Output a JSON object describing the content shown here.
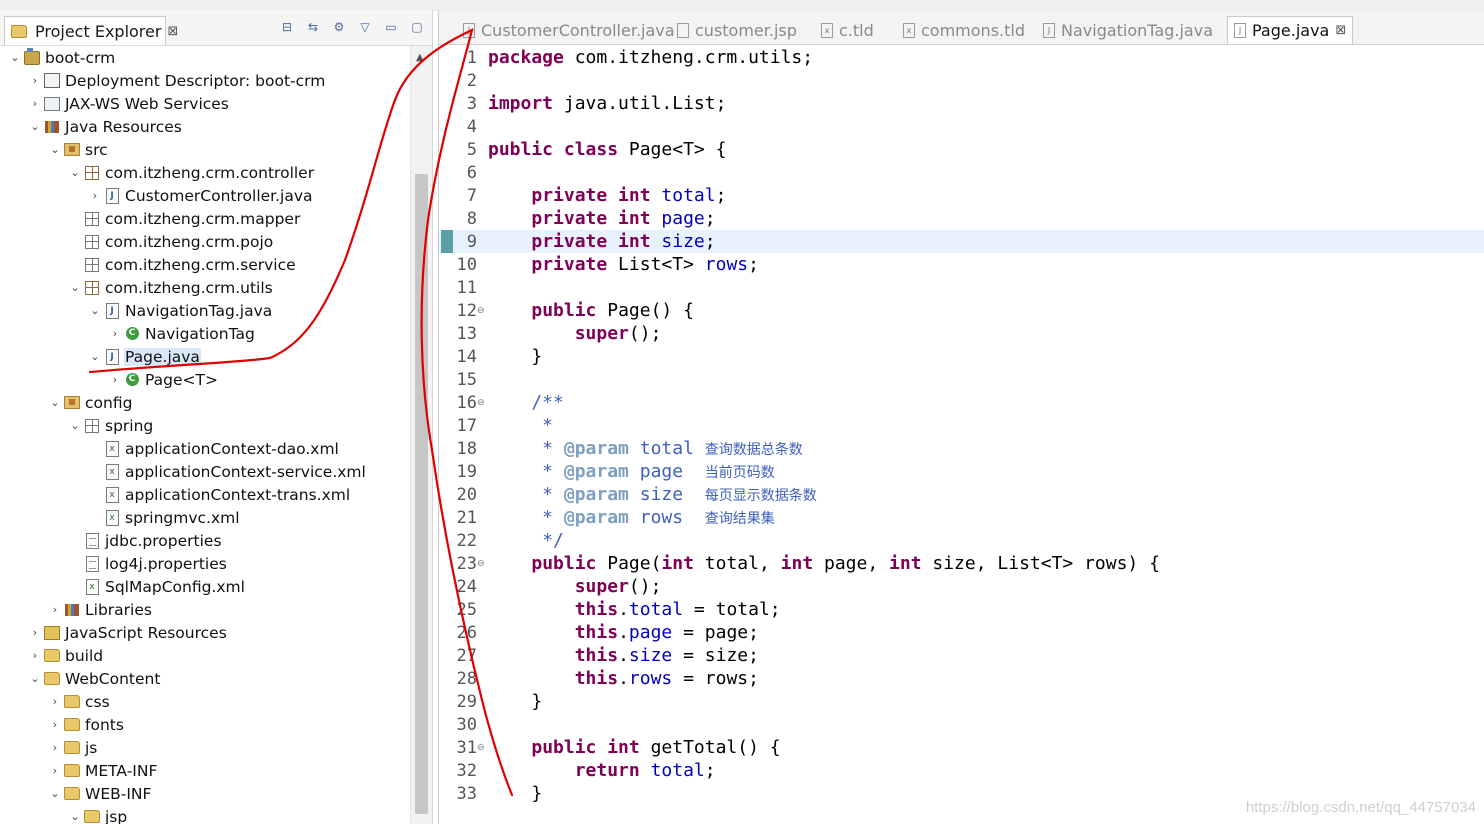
{
  "explorer": {
    "tab_title": "Project Explorer",
    "tab_close": "⊠",
    "tree": [
      {
        "label": "boot-crm",
        "level": 0,
        "twisty": "open",
        "icon": "project-icon"
      },
      {
        "label": "Deployment Descriptor: boot-crm",
        "level": 1,
        "twisty": "closed",
        "icon": "descriptor-icon"
      },
      {
        "label": "JAX-WS Web Services",
        "level": 1,
        "twisty": "closed",
        "icon": "webservices-icon"
      },
      {
        "label": "Java Resources",
        "level": 1,
        "twisty": "open",
        "icon": "java-resources-icon"
      },
      {
        "label": "src",
        "level": 2,
        "twisty": "open",
        "icon": "source-folder-icon"
      },
      {
        "label": "com.itzheng.crm.controller",
        "level": 3,
        "twisty": "open",
        "icon": "package-icon"
      },
      {
        "label": "CustomerController.java",
        "level": 4,
        "twisty": "closed",
        "icon": "java-file-icon"
      },
      {
        "label": "com.itzheng.crm.mapper",
        "level": 3,
        "twisty": "none",
        "icon": "empty-package-icon"
      },
      {
        "label": "com.itzheng.crm.pojo",
        "level": 3,
        "twisty": "none",
        "icon": "empty-package-icon"
      },
      {
        "label": "com.itzheng.crm.service",
        "level": 3,
        "twisty": "none",
        "icon": "empty-package-icon"
      },
      {
        "label": "com.itzheng.crm.utils",
        "level": 3,
        "twisty": "open",
        "icon": "package-icon"
      },
      {
        "label": "NavigationTag.java",
        "level": 4,
        "twisty": "open",
        "icon": "java-file-icon"
      },
      {
        "label": "NavigationTag",
        "level": 5,
        "twisty": "closed",
        "icon": "class-icon"
      },
      {
        "label": "Page.java",
        "level": 4,
        "twisty": "open",
        "icon": "java-file-icon",
        "selected": true
      },
      {
        "label": "Page<T>",
        "level": 5,
        "twisty": "closed",
        "icon": "class-icon"
      },
      {
        "label": "config",
        "level": 2,
        "twisty": "open",
        "icon": "source-folder-icon"
      },
      {
        "label": "spring",
        "level": 3,
        "twisty": "open",
        "icon": "empty-package-icon"
      },
      {
        "label": "applicationContext-dao.xml",
        "level": 4,
        "twisty": "none",
        "icon": "xml-file-icon"
      },
      {
        "label": "applicationContext-service.xml",
        "level": 4,
        "twisty": "none",
        "icon": "xml-file-icon"
      },
      {
        "label": "applicationContext-trans.xml",
        "level": 4,
        "twisty": "none",
        "icon": "xml-file-icon"
      },
      {
        "label": "springmvc.xml",
        "level": 4,
        "twisty": "none",
        "icon": "xml-file-icon"
      },
      {
        "label": "jdbc.properties",
        "level": 3,
        "twisty": "none",
        "icon": "properties-file-icon"
      },
      {
        "label": "log4j.properties",
        "level": 3,
        "twisty": "none",
        "icon": "properties-file-icon"
      },
      {
        "label": "SqlMapConfig.xml",
        "level": 3,
        "twisty": "none",
        "icon": "xml-file-icon"
      },
      {
        "label": "Libraries",
        "level": 2,
        "twisty": "closed",
        "icon": "libraries-icon"
      },
      {
        "label": "JavaScript Resources",
        "level": 1,
        "twisty": "closed",
        "icon": "javascript-resources-icon"
      },
      {
        "label": "build",
        "level": 1,
        "twisty": "closed",
        "icon": "folder-icon"
      },
      {
        "label": "WebContent",
        "level": 1,
        "twisty": "open",
        "icon": "folder-icon"
      },
      {
        "label": "css",
        "level": 2,
        "twisty": "closed",
        "icon": "folder-icon"
      },
      {
        "label": "fonts",
        "level": 2,
        "twisty": "closed",
        "icon": "folder-icon"
      },
      {
        "label": "js",
        "level": 2,
        "twisty": "closed",
        "icon": "folder-icon"
      },
      {
        "label": "META-INF",
        "level": 2,
        "twisty": "closed",
        "icon": "folder-icon"
      },
      {
        "label": "WEB-INF",
        "level": 2,
        "twisty": "open",
        "icon": "folder-icon"
      },
      {
        "label": "jsp",
        "level": 3,
        "twisty": "open",
        "icon": "folder-icon"
      }
    ]
  },
  "editor": {
    "tabs": [
      {
        "label": "CustomerController.java",
        "icon": "java-file-icon",
        "active": false
      },
      {
        "label": "customer.jsp",
        "icon": "jsp-file-icon",
        "active": false
      },
      {
        "label": "c.tld",
        "icon": "tld-file-icon",
        "active": false
      },
      {
        "label": "commons.tld",
        "icon": "tld-file-icon",
        "active": false
      },
      {
        "label": "NavigationTag.java",
        "icon": "java-file-icon",
        "active": false
      },
      {
        "label": "Page.java",
        "icon": "java-file-icon",
        "active": true
      }
    ],
    "tab_close": "⊠",
    "current_line": 9,
    "lines": [
      [
        {
          "t": "package",
          "c": "kw"
        },
        {
          "t": " com.itzheng.crm.utils;"
        }
      ],
      [],
      [
        {
          "t": "import",
          "c": "kw"
        },
        {
          "t": " java.util.List;"
        }
      ],
      [],
      [
        {
          "t": "public class",
          "c": "kw"
        },
        {
          "t": " Page<T> {"
        }
      ],
      [],
      [
        {
          "t": "    "
        },
        {
          "t": "private int",
          "c": "kw"
        },
        {
          "t": " "
        },
        {
          "t": "total",
          "c": "fld"
        },
        {
          "t": ";"
        }
      ],
      [
        {
          "t": "    "
        },
        {
          "t": "private int",
          "c": "kw"
        },
        {
          "t": " "
        },
        {
          "t": "page",
          "c": "fld"
        },
        {
          "t": ";"
        }
      ],
      [
        {
          "t": "    "
        },
        {
          "t": "private int",
          "c": "kw"
        },
        {
          "t": " "
        },
        {
          "t": "size",
          "c": "fld"
        },
        {
          "t": ";"
        }
      ],
      [
        {
          "t": "    "
        },
        {
          "t": "private",
          "c": "kw"
        },
        {
          "t": " List<T> "
        },
        {
          "t": "rows",
          "c": "fld"
        },
        {
          "t": ";"
        }
      ],
      [],
      [
        {
          "t": "    "
        },
        {
          "t": "public",
          "c": "kw"
        },
        {
          "t": " Page() {"
        }
      ],
      [
        {
          "t": "        "
        },
        {
          "t": "super",
          "c": "kw"
        },
        {
          "t": "();"
        }
      ],
      [
        {
          "t": "    }"
        }
      ],
      [],
      [
        {
          "t": "    /**",
          "c": "cm"
        }
      ],
      [
        {
          "t": "     *",
          "c": "cm"
        }
      ],
      [
        {
          "t": "     * ",
          "c": "cm"
        },
        {
          "t": "@param",
          "c": "tag"
        },
        {
          "t": " total ",
          "c": "cm"
        },
        {
          "t": "查询数据总条数",
          "c": "cn"
        }
      ],
      [
        {
          "t": "     * ",
          "c": "cm"
        },
        {
          "t": "@param",
          "c": "tag"
        },
        {
          "t": " page  ",
          "c": "cm"
        },
        {
          "t": "当前页码数",
          "c": "cn"
        }
      ],
      [
        {
          "t": "     * ",
          "c": "cm"
        },
        {
          "t": "@param",
          "c": "tag"
        },
        {
          "t": " size  ",
          "c": "cm"
        },
        {
          "t": "每页显示数据条数",
          "c": "cn"
        }
      ],
      [
        {
          "t": "     * ",
          "c": "cm"
        },
        {
          "t": "@param",
          "c": "tag"
        },
        {
          "t": " rows  ",
          "c": "cm"
        },
        {
          "t": "查询结果集",
          "c": "cn"
        }
      ],
      [
        {
          "t": "     */",
          "c": "cm"
        }
      ],
      [
        {
          "t": "    "
        },
        {
          "t": "public",
          "c": "kw"
        },
        {
          "t": " Page("
        },
        {
          "t": "int",
          "c": "kw"
        },
        {
          "t": " total, "
        },
        {
          "t": "int",
          "c": "kw"
        },
        {
          "t": " page, "
        },
        {
          "t": "int",
          "c": "kw"
        },
        {
          "t": " size, List<T> rows) {"
        }
      ],
      [
        {
          "t": "        "
        },
        {
          "t": "super",
          "c": "kw"
        },
        {
          "t": "();"
        }
      ],
      [
        {
          "t": "        "
        },
        {
          "t": "this",
          "c": "kw"
        },
        {
          "t": "."
        },
        {
          "t": "total",
          "c": "fld"
        },
        {
          "t": " = total;"
        }
      ],
      [
        {
          "t": "        "
        },
        {
          "t": "this",
          "c": "kw"
        },
        {
          "t": "."
        },
        {
          "t": "page",
          "c": "fld"
        },
        {
          "t": " = page;"
        }
      ],
      [
        {
          "t": "        "
        },
        {
          "t": "this",
          "c": "kw"
        },
        {
          "t": "."
        },
        {
          "t": "size",
          "c": "fld"
        },
        {
          "t": " = size;"
        }
      ],
      [
        {
          "t": "        "
        },
        {
          "t": "this",
          "c": "kw"
        },
        {
          "t": "."
        },
        {
          "t": "rows",
          "c": "fld"
        },
        {
          "t": " = rows;"
        }
      ],
      [
        {
          "t": "    }"
        }
      ],
      [],
      [
        {
          "t": "    "
        },
        {
          "t": "public int",
          "c": "kw"
        },
        {
          "t": " getTotal() {"
        }
      ],
      [
        {
          "t": "        "
        },
        {
          "t": "return",
          "c": "kw"
        },
        {
          "t": " "
        },
        {
          "t": "total",
          "c": "fld"
        },
        {
          "t": ";"
        }
      ],
      [
        {
          "t": "    }"
        }
      ]
    ],
    "fold_lines": [
      12,
      16,
      23,
      31
    ]
  },
  "watermark": "https://blog.csdn.net/qq_44757034",
  "colors": {
    "keyword": "#7f0055",
    "field": "#0000c0",
    "javadoc": "#3f5fbf",
    "annotation_stroke": "#e00000",
    "selection": "#d9e8fb",
    "current_line": "#e8f2fe"
  }
}
